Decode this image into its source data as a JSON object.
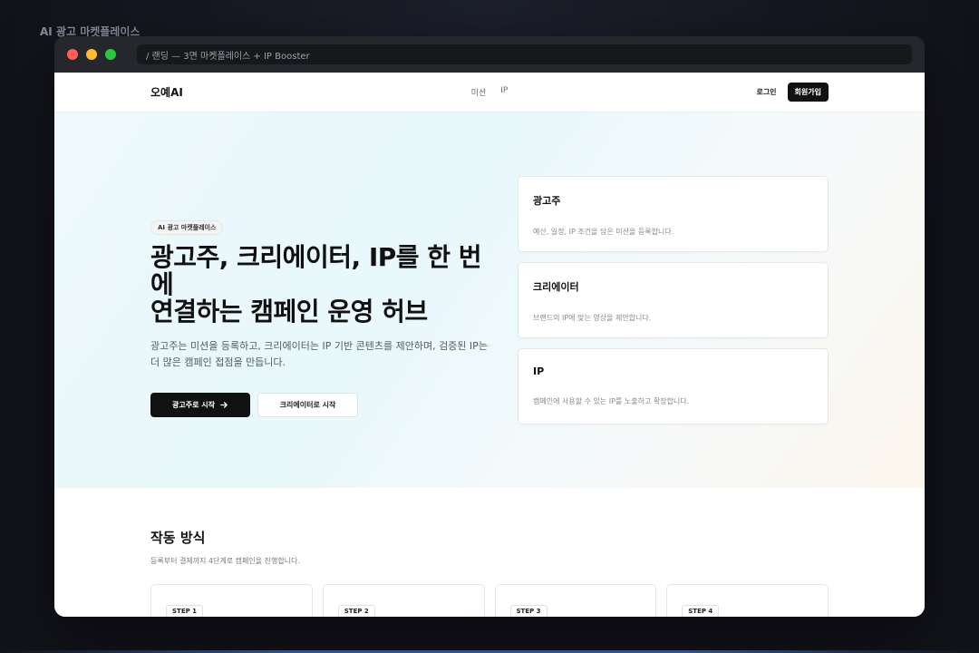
{
  "outer_title": "AI 광고 마켓플레이스",
  "window": {
    "url": "/ 랜딩 — 3면 마켓플레이스 + IP Booster"
  },
  "nav": {
    "logo": "오예AI",
    "links": [
      "미션",
      "IP"
    ],
    "login": "로그인",
    "signup": "회원가입"
  },
  "hero": {
    "badge": "AI 광고 마켓플레이스",
    "title_line1": "광고주, 크리에이터, IP를 한 번에",
    "title_line2": "연결하는 캠페인 운영 허브",
    "desc_line1": "광고주는 미션을 등록하고, 크리에이터는 IP 기반 콘텐츠를 제안하며, 검증된 IP는",
    "desc_line2": "더 많은 캠페인 접점을 만듭니다.",
    "primary_btn": "광고주로 시작",
    "secondary_btn": "크리에이터로 시작"
  },
  "cards": [
    {
      "title": "광고주",
      "desc": "예산, 일정, IP 조건을 담은 미션을 등록합니다."
    },
    {
      "title": "크리에이터",
      "desc": "브랜드의 IP에 맞는 영상을 제안합니다."
    },
    {
      "title": "IP",
      "desc": "캠페인에 사용할 수 있는 IP를 노출하고 확장합니다."
    }
  ],
  "how": {
    "title": "작동 방식",
    "subtitle": "등록부터 결제까지 4단계로 캠페인을 진행합니다.",
    "steps": [
      "STEP 1",
      "STEP 2",
      "STEP 3",
      "STEP 4"
    ]
  },
  "icons": {
    "arrow": "arrow-right-icon"
  },
  "colors": {
    "primary": "#111111",
    "hero_bg": "#e8f8fb"
  }
}
